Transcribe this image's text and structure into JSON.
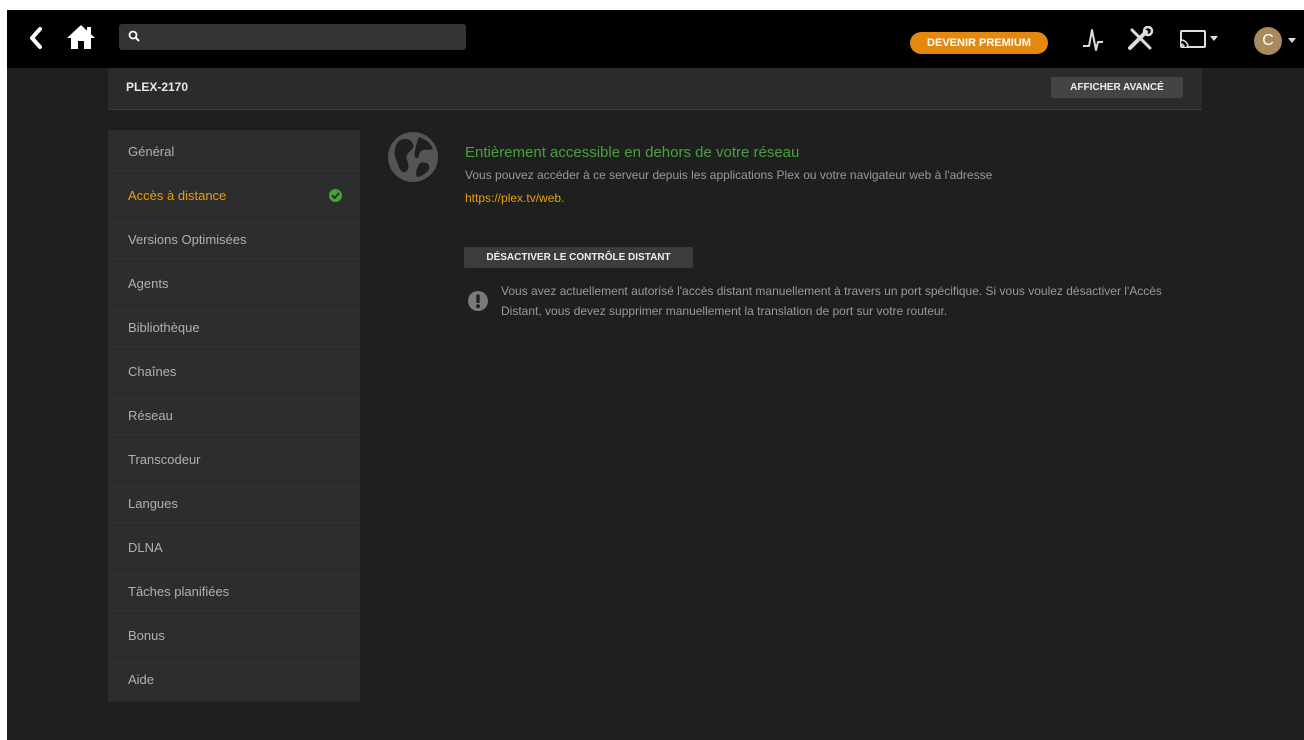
{
  "topbar": {
    "back_icon": "chevron-left-icon",
    "home_icon": "home-icon",
    "search": {
      "placeholder": "",
      "value": ""
    },
    "premium_label": "DEVENIR PREMIUM",
    "activity_icon": "activity-icon",
    "tools_icon": "tools-icon",
    "cast_icon": "cast-icon",
    "avatar_letter": "C"
  },
  "server": {
    "name": "PLEX-2170",
    "advanced_button": "AFFICHER AVANCÉ"
  },
  "sidebar": {
    "items": [
      {
        "label": "Général"
      },
      {
        "label": "Accès à distance",
        "active": true,
        "status_icon": "check-circle-icon"
      },
      {
        "label": "Versions Optimisées"
      },
      {
        "label": "Agents"
      },
      {
        "label": "Bibliothèque"
      },
      {
        "label": "Chaînes"
      },
      {
        "label": "Réseau"
      },
      {
        "label": "Transcodeur"
      },
      {
        "label": "Langues"
      },
      {
        "label": "DLNA"
      },
      {
        "label": "Tâches planifiées"
      },
      {
        "label": "Bonus"
      },
      {
        "label": "Aide"
      }
    ]
  },
  "main": {
    "status_title": "Entièrement accessible en dehors de votre réseau",
    "status_desc": "Vous pouvez accéder à ce serveur depuis les applications Plex ou votre navigateur web à l'adresse",
    "status_link": "https://plex.tv/web.",
    "disable_button": "DÉSACTIVER LE CONTRÔLE DISTANT",
    "warning_text": "Vous avez actuellement autorisé l'accès distant manuellement à travers un port spécifique. Si vous voulez désactiver l'Accès Distant, vous devez supprimer manuellement la translation de port sur votre routeur."
  },
  "colors": {
    "accent": "#e5a00d",
    "premium": "#e5880f",
    "success": "#46a33a",
    "background": "#1f1f1f"
  }
}
